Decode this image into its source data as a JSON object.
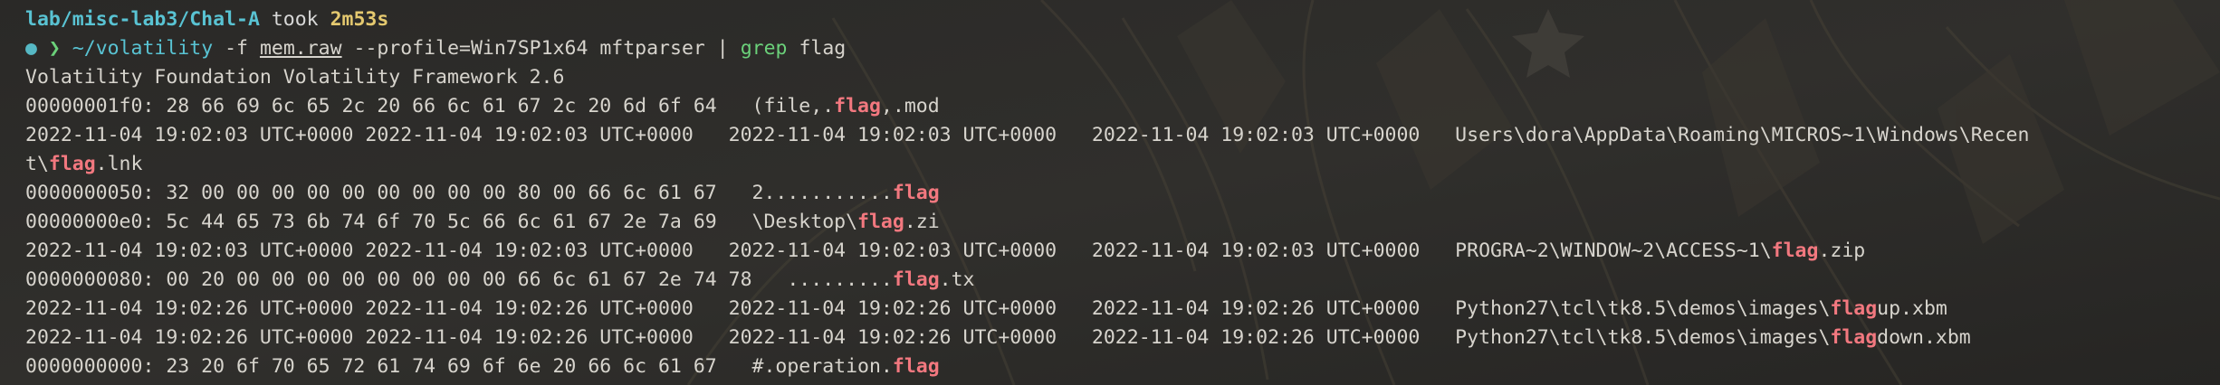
{
  "window": {
    "prompt_path": "lab/misc-lab3/Chal-A",
    "took_label": "took",
    "duration": "2m53s"
  },
  "command": {
    "prompt_dot": "●",
    "prompt_arrow": "❯",
    "program": "~/volatility",
    "flag_file": "-f",
    "file_name": "mem.raw",
    "profile_arg": "--profile=Win7SP1x64 mftparser",
    "pipe": "|",
    "grep_cmd": "grep",
    "grep_pattern": "flag"
  },
  "output_lines": [
    {
      "segments": [
        {
          "text": "Volatility Foundation Volatility Framework 2.6",
          "kind": "normal"
        }
      ]
    },
    {
      "segments": [
        {
          "text": "00000001f0: 28 66 69 6c 65 2c 20 66 6c 61 67 2c 20 6d 6f 64   (file,.",
          "kind": "normal"
        },
        {
          "text": "flag",
          "kind": "flag"
        },
        {
          "text": ",.mod",
          "kind": "normal"
        }
      ]
    },
    {
      "segments": [
        {
          "text": "2022-11-04 19:02:03 UTC+0000 2022-11-04 19:02:03 UTC+0000   2022-11-04 19:02:03 UTC+0000   2022-11-04 19:02:03 UTC+0000   Users\\dora\\AppData\\Roaming\\MICROS~1\\Windows\\Recen",
          "kind": "normal"
        }
      ]
    },
    {
      "segments": [
        {
          "text": "t\\",
          "kind": "normal"
        },
        {
          "text": "flag",
          "kind": "flag"
        },
        {
          "text": ".lnk",
          "kind": "normal"
        }
      ]
    },
    {
      "segments": [
        {
          "text": "0000000050: 32 00 00 00 00 00 00 00 00 00 80 00 66 6c 61 67   2...........",
          "kind": "normal"
        },
        {
          "text": "flag",
          "kind": "flag"
        }
      ]
    },
    {
      "segments": [
        {
          "text": "00000000e0: 5c 44 65 73 6b 74 6f 70 5c 66 6c 61 67 2e 7a 69   \\Desktop\\",
          "kind": "normal"
        },
        {
          "text": "flag",
          "kind": "flag"
        },
        {
          "text": ".zi",
          "kind": "normal"
        }
      ]
    },
    {
      "segments": [
        {
          "text": "2022-11-04 19:02:03 UTC+0000 2022-11-04 19:02:03 UTC+0000   2022-11-04 19:02:03 UTC+0000   2022-11-04 19:02:03 UTC+0000   PROGRA~2\\WINDOW~2\\ACCESS~1\\",
          "kind": "normal"
        },
        {
          "text": "flag",
          "kind": "flag"
        },
        {
          "text": ".zip",
          "kind": "normal"
        }
      ]
    },
    {
      "segments": [
        {
          "text": "0000000080: 00 20 00 00 00 00 00 00 00 00 66 6c 61 67 2e 74 78   .........",
          "kind": "normal"
        },
        {
          "text": "flag",
          "kind": "flag"
        },
        {
          "text": ".tx",
          "kind": "normal"
        }
      ]
    },
    {
      "segments": [
        {
          "text": "2022-11-04 19:02:26 UTC+0000 2022-11-04 19:02:26 UTC+0000   2022-11-04 19:02:26 UTC+0000   2022-11-04 19:02:26 UTC+0000   Python27\\tcl\\tk8.5\\demos\\images\\",
          "kind": "normal"
        },
        {
          "text": "flag",
          "kind": "flag"
        },
        {
          "text": "up.xbm",
          "kind": "normal"
        }
      ]
    },
    {
      "segments": [
        {
          "text": "2022-11-04 19:02:26 UTC+0000 2022-11-04 19:02:26 UTC+0000   2022-11-04 19:02:26 UTC+0000   2022-11-04 19:02:26 UTC+0000   Python27\\tcl\\tk8.5\\demos\\images\\",
          "kind": "normal"
        },
        {
          "text": "flag",
          "kind": "flag"
        },
        {
          "text": "down.xbm",
          "kind": "normal"
        }
      ]
    },
    {
      "segments": [
        {
          "text": "0000000000: 23 20 6f 70 65 72 61 74 69 6f 6e 20 66 6c 61 67   #.operation.",
          "kind": "normal"
        },
        {
          "text": "flag",
          "kind": "flag"
        }
      ]
    }
  ],
  "colors": {
    "background": "#2b2a28",
    "path": "#59c3d3",
    "duration": "#e5c96f",
    "prompt_arrow": "#6bd17a",
    "grep": "#6bd17a",
    "highlight": "#f2787f",
    "text": "#d7d4cd"
  }
}
